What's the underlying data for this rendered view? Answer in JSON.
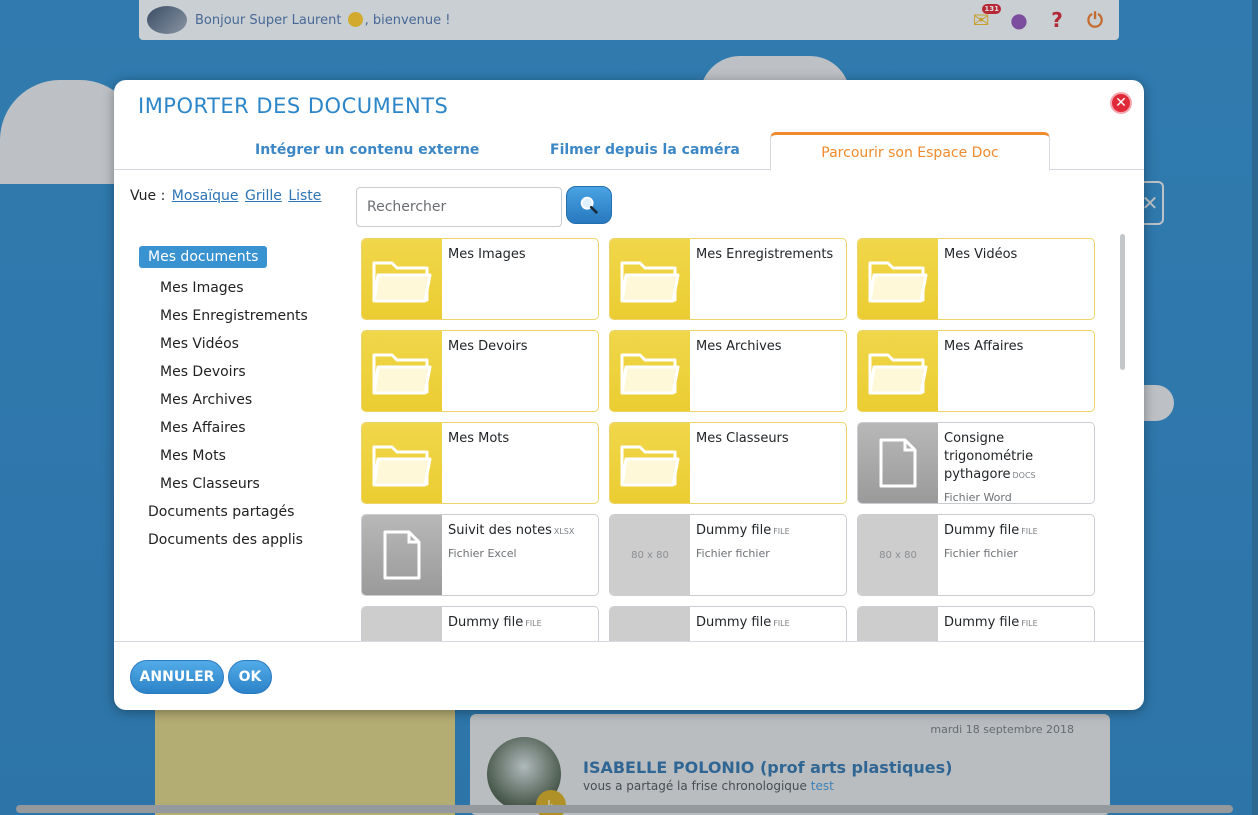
{
  "topbar": {
    "greeting_prefix": "Bonjour Super Laurent",
    "greeting_suffix": ", bienvenue !",
    "mail_count": "131"
  },
  "background_card": {
    "date": "mardi 18 septembre 2018",
    "author": "ISABELLE POLONIO (prof arts plastiques)",
    "message": "vous a partagé la frise chronologique",
    "link": "test"
  },
  "modal": {
    "title": "IMPORTER DES DOCUMENTS",
    "tabs": [
      {
        "label": "Intégrer un contenu externe"
      },
      {
        "label": "Filmer depuis la caméra"
      },
      {
        "label": "Parcourir son Espace Doc",
        "active": true
      }
    ],
    "view": {
      "label": "Vue :",
      "options": [
        "Mosaïque",
        "Grille",
        "Liste"
      ]
    },
    "search": {
      "placeholder": "Rechercher"
    },
    "tree": {
      "root": "Mes documents",
      "children": [
        "Mes Images",
        "Mes Enregistrements",
        "Mes Vidéos",
        "Mes Devoirs",
        "Mes Archives",
        "Mes Affaires",
        "Mes Mots",
        "Mes Classeurs"
      ],
      "others": [
        "Documents partagés",
        "Documents des applis"
      ]
    },
    "tiles": [
      {
        "kind": "folder",
        "name": "Mes Images"
      },
      {
        "kind": "folder",
        "name": "Mes Enregistrements"
      },
      {
        "kind": "folder",
        "name": "Mes Vidéos"
      },
      {
        "kind": "folder",
        "name": "Mes Devoirs"
      },
      {
        "kind": "folder",
        "name": "Mes Archives"
      },
      {
        "kind": "folder",
        "name": "Mes Affaires"
      },
      {
        "kind": "folder",
        "name": "Mes Mots"
      },
      {
        "kind": "folder",
        "name": "Mes Classeurs"
      },
      {
        "kind": "doc",
        "name": "Consigne trigonométrie pythagore",
        "ext": "docs",
        "type": "Fichier Word"
      },
      {
        "kind": "doc",
        "name": "Suivit des notes",
        "ext": "xlsx",
        "type": "Fichier Excel"
      },
      {
        "kind": "placeholder",
        "name": "Dummy file",
        "ext": "file",
        "type": "Fichier fichier",
        "thumb_text": "80 x 80"
      },
      {
        "kind": "placeholder",
        "name": "Dummy file",
        "ext": "file",
        "type": "Fichier fichier",
        "thumb_text": "80 x 80"
      },
      {
        "kind": "placeholder",
        "name": "Dummy file",
        "ext": "file",
        "type": "",
        "thumb_text": ""
      },
      {
        "kind": "placeholder",
        "name": "Dummy file",
        "ext": "file",
        "type": "",
        "thumb_text": ""
      },
      {
        "kind": "placeholder",
        "name": "Dummy file",
        "ext": "file",
        "type": "",
        "thumb_text": ""
      }
    ],
    "buttons": {
      "cancel": "ANNULER",
      "ok": "OK"
    }
  },
  "colors": {
    "accent_blue": "#2d86c8",
    "active_tab": "#f08a2d",
    "folder_yellow": "#ebcd32",
    "close_red": "#e02a39"
  }
}
